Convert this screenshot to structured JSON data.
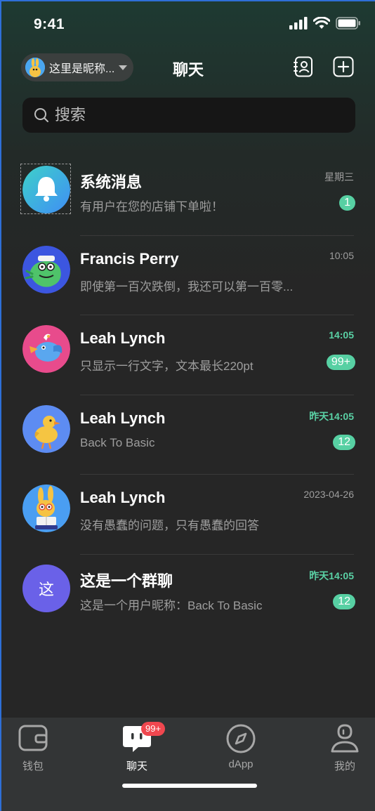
{
  "status": {
    "time": "9:41"
  },
  "header": {
    "nickname": "这里是昵称...",
    "title": "聊天"
  },
  "search": {
    "placeholder": "搜索"
  },
  "chats": [
    {
      "name": "系统消息",
      "preview": "有用户在您的店铺下单啦！",
      "time": "星期三",
      "time_highlight": false,
      "badge": "1",
      "avatar": "bell-icon"
    },
    {
      "name": "Francis Perry",
      "preview": "即使第一百次跌倒，我还可以第一百零...",
      "time": "10:05",
      "time_highlight": false,
      "badge": "",
      "avatar": "green-monster"
    },
    {
      "name": "Leah Lynch",
      "preview": "只显示一行文字，文本最长220pt",
      "time": "14:05",
      "time_highlight": true,
      "badge": "99+",
      "avatar": "blue-bird"
    },
    {
      "name": "Leah Lynch",
      "preview": "Back To Basic",
      "time": "昨天14:05",
      "time_highlight": true,
      "badge": "12",
      "avatar": "yellow-duck"
    },
    {
      "name": "Leah Lynch",
      "preview": "没有愚蠢的问题，只有愚蠢的回答",
      "time": "2023-04-26",
      "time_highlight": false,
      "badge": "",
      "avatar": "rabbit-reader"
    },
    {
      "name": "这是一个群聊",
      "preview": "这是一个用户昵称：Back To Basic",
      "time": "昨天14:05",
      "time_highlight": true,
      "badge": "12",
      "avatar": "group",
      "avatar_text": "这"
    }
  ],
  "tabs": [
    {
      "label": "钱包",
      "icon": "wallet-icon",
      "active": false
    },
    {
      "label": "聊天",
      "icon": "chat-icon",
      "active": true,
      "badge": "99+"
    },
    {
      "label": "dApp",
      "icon": "compass-icon",
      "active": false
    },
    {
      "label": "我的",
      "icon": "profile-icon",
      "active": false
    }
  ],
  "colors": {
    "accent": "#57d0a3",
    "badge_red": "#f0474f",
    "background": "#262626"
  }
}
